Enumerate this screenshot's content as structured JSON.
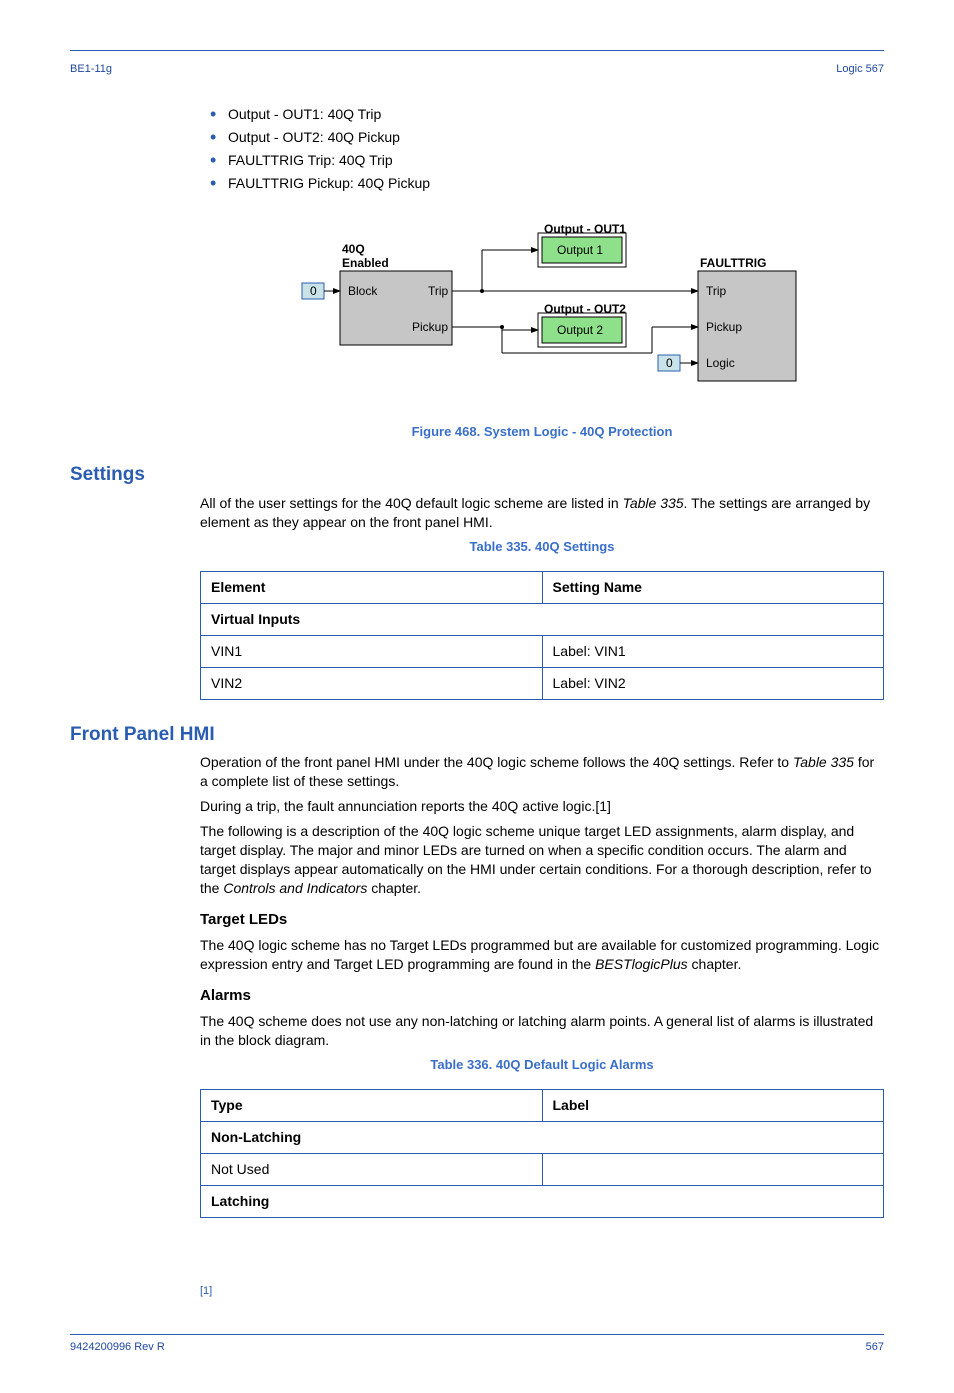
{
  "header": {
    "left": "BE1-11g",
    "right": "Logic 567"
  },
  "bullets": [
    "Output - OUT1: 40Q Trip",
    "Output - OUT2: 40Q Pickup",
    "FAULTTRIG Trip: 40Q Trip",
    "FAULTTRIG Pickup: 40Q Pickup"
  ],
  "figCaption": "Figure 468. System Logic - 40Q Protection",
  "sectionSettings": "Settings",
  "settingsIntro": {
    "l1": "All of the user settings for the 40Q default logic scheme are listed in ",
    "l1i": "Table 335",
    "l1b": ". The settings are arranged by element as they appear on the front panel HMI."
  },
  "table335Label": "Table 335. 40Q Settings",
  "table335": {
    "r1c1": "Element",
    "r1c2": "Setting Name",
    "r2c1": "Virtual Inputs",
    "r3c1": "VIN1",
    "r3c2": "Label: VIN1",
    "r4c1": "VIN2",
    "r4c2": "Label: VIN2"
  },
  "sectionHmi": "Front Panel HMI",
  "hmiPara": {
    "p1a": "Operation of the front panel HMI under the 40Q logic scheme follows the 40Q settings. Refer to ",
    "p1i": "Table 335",
    "p1b": " for a complete list of these settings.",
    "p2": "During a trip, the fault annunciation reports the 40Q active logic.[1]",
    "p3a": "The following is a description of the 40Q logic scheme unique target LED assignments, alarm display, and target display. The major and minor LEDs are turned on when a specific condition occurs. The alarm and target displays appear automatically on the HMI under certain conditions. For a thorough description, refer to the ",
    "p3i": "Controls and Indicators",
    "p3b": " chapter."
  },
  "targetLedsHeading": "Target LEDs",
  "targetLedsPara": {
    "a": "The 40Q logic scheme has no Target LEDs programmed but are available for customized programming. Logic expression entry and Target LED programming are found in the ",
    "i": "BESTlogicPlus",
    "b": " chapter."
  },
  "alarmsHeading": "Alarms",
  "alarmsPara": "The 40Q scheme does not use any non-latching or latching alarm points. A general list of alarms is illustrated in the block diagram.",
  "table336Label": "Table 336. 40Q Default Logic Alarms",
  "table336": {
    "r1c1": "Type",
    "r1c2": "Label",
    "r2c1": "Non-Latching",
    "r3c1": "Not Used",
    "r3c2": "",
    "r4c1": "Latching",
    "r4c2": ""
  },
  "footnote": "[1]",
  "footer": {
    "left": "9424200996 Rev R",
    "right": "567"
  },
  "diagram": {
    "out1Label": "Output - OUT1",
    "out1Box": "Output 1",
    "out2Label": "Output - OUT2",
    "out2Box": "Output 2",
    "block40qTitle1": "40Q",
    "block40qTitle2": "Enabled",
    "blockInBlock": "Block",
    "tripOut": "Trip",
    "pickupOut": "Pickup",
    "faultTitle": "FAULTTRIG",
    "faultTrip": "Trip",
    "faultPickup": "Pickup",
    "faultLogic": "Logic",
    "zero": "0"
  }
}
